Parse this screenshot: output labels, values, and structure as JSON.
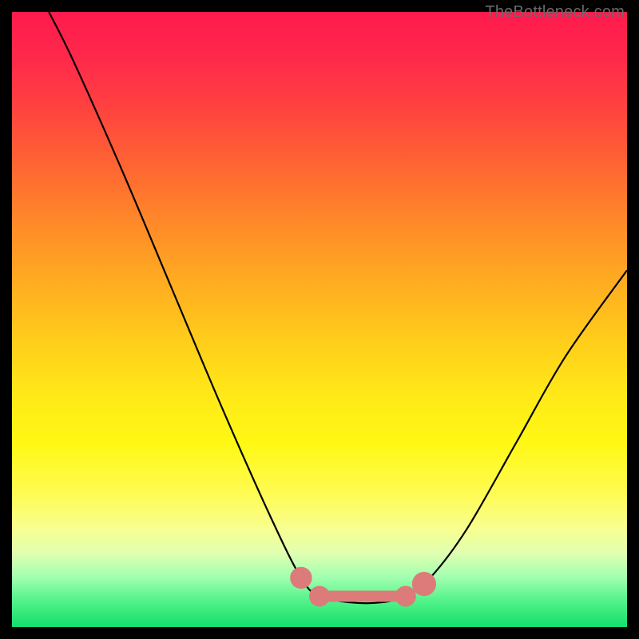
{
  "watermark": "TheBottleneck.com",
  "chart_data": {
    "type": "line",
    "title": "",
    "xlabel": "",
    "ylabel": "",
    "xlim": [
      0,
      100
    ],
    "ylim": [
      0,
      100
    ],
    "series": [
      {
        "name": "curve",
        "points": [
          {
            "x": 6,
            "y": 100
          },
          {
            "x": 10,
            "y": 92
          },
          {
            "x": 18,
            "y": 74
          },
          {
            "x": 26,
            "y": 55
          },
          {
            "x": 34,
            "y": 36
          },
          {
            "x": 42,
            "y": 18
          },
          {
            "x": 47,
            "y": 8
          },
          {
            "x": 50,
            "y": 5
          },
          {
            "x": 55,
            "y": 4
          },
          {
            "x": 60,
            "y": 4
          },
          {
            "x": 64,
            "y": 5
          },
          {
            "x": 68,
            "y": 8
          },
          {
            "x": 74,
            "y": 16
          },
          {
            "x": 82,
            "y": 30
          },
          {
            "x": 90,
            "y": 44
          },
          {
            "x": 100,
            "y": 58
          }
        ]
      }
    ],
    "marks": [
      {
        "name": "left-dot",
        "x": 47,
        "y": 8,
        "r": 1.4
      },
      {
        "name": "flat-band-left",
        "x": 50,
        "y": 5,
        "r": 1.3
      },
      {
        "name": "flat-band-right",
        "x": 64,
        "y": 5,
        "r": 1.3
      },
      {
        "name": "right-dot",
        "x": 67,
        "y": 7,
        "r": 1.6
      }
    ],
    "colors": {
      "curve": "#000000",
      "marks": "#dd7a7a"
    }
  }
}
